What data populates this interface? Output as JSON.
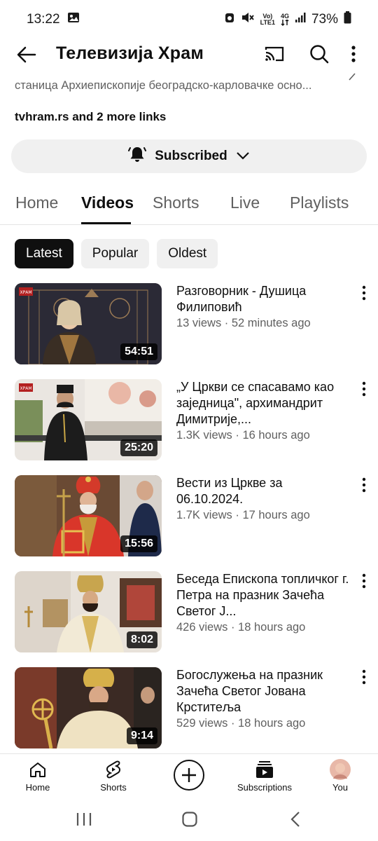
{
  "status_bar": {
    "time": "13:22",
    "network_top": "Vo)",
    "network_bottom": "LTE1",
    "network_gen": "4G",
    "battery": "73%"
  },
  "header": {
    "title": "Телевизија Храм"
  },
  "channel": {
    "description": "станица Архиепископије београдско-карловачке осно...",
    "links": "tvhram.rs and 2 more links",
    "subscribe_label": "Subscribed"
  },
  "tabs": [
    "Home",
    "Videos",
    "Shorts",
    "Live",
    "Playlists"
  ],
  "chips": [
    "Latest",
    "Popular",
    "Oldest"
  ],
  "videos": [
    {
      "title": "Разговорник - Душица Филиповић",
      "meta": "13 views · 52 minutes ago",
      "duration": "54:51"
    },
    {
      "title": "„У Цркви се спасавамо као заједница\", архимандрит Димитрије,...",
      "meta": "1.3K views · 16 hours ago",
      "duration": "25:20"
    },
    {
      "title": "Вести из Цркве за 06.10.2024.",
      "meta": "1.7K views · 17 hours ago",
      "duration": "15:56"
    },
    {
      "title": "Беседа Епископа топличког г. Петра на празник Зачећа Светог Ј...",
      "meta": "426 views · 18 hours ago",
      "duration": "8:02"
    },
    {
      "title": "Богослужења на празник Зачећа Светог Јована Крститеља",
      "meta": "529 views · 18 hours ago",
      "duration": "9:14"
    }
  ],
  "thumb_logo": "ХРАМ",
  "bottom_nav": {
    "home": "Home",
    "shorts": "Shorts",
    "subscriptions": "Subscriptions",
    "you": "You"
  },
  "colors": {
    "text_primary": "#0f0f0f",
    "text_secondary": "#606060",
    "chip_bg": "#f0f0f0",
    "chip_active_bg": "#0f0f0f"
  }
}
